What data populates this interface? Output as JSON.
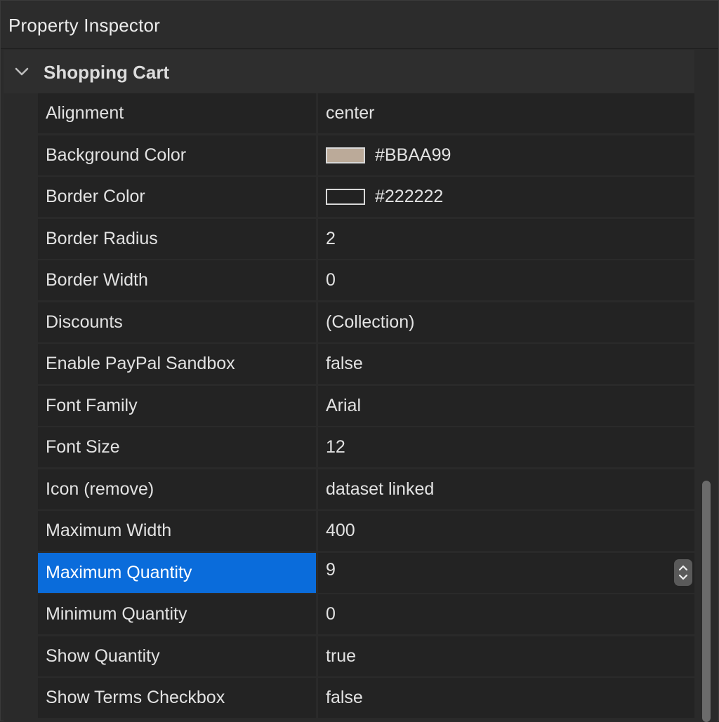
{
  "window": {
    "title": "Property Inspector"
  },
  "section": {
    "title": "Shopping Cart",
    "expanded": true,
    "chevron_icon": "chevron-down-icon"
  },
  "properties": [
    {
      "name": "Alignment",
      "value": "center"
    },
    {
      "name": "Background Color",
      "value": "#BBAA99",
      "swatch": "#BBAA99"
    },
    {
      "name": "Border Color",
      "value": "#222222",
      "swatch": "#222222"
    },
    {
      "name": "Border Radius",
      "value": "2"
    },
    {
      "name": "Border Width",
      "value": "0"
    },
    {
      "name": "Discounts",
      "value": "(Collection)"
    },
    {
      "name": "Enable PayPal Sandbox",
      "value": "false"
    },
    {
      "name": "Font Family",
      "value": "Arial"
    },
    {
      "name": "Font Size",
      "value": "12"
    },
    {
      "name": "Icon (remove)",
      "value": "dataset linked"
    },
    {
      "name": "Maximum Width",
      "value": "400"
    },
    {
      "name": "Maximum Quantity",
      "value": "9",
      "selected": true,
      "stepper": true
    },
    {
      "name": "Minimum Quantity",
      "value": "0"
    },
    {
      "name": "Show Quantity",
      "value": "true"
    },
    {
      "name": "Show Terms Checkbox",
      "value": "false"
    }
  ],
  "colors": {
    "selection": "#0a6cdb",
    "row_bg": "#232323",
    "panel_bg": "#2a2a2a"
  }
}
